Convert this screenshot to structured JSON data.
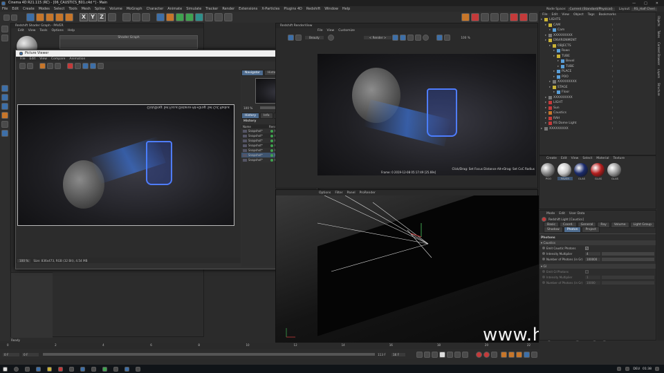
{
  "window_title": "Cinema 4D R21.115 (RC) - [06_CAUSTICS_B01.c4d *] - Main",
  "window_controls": [
    "—",
    "□",
    "✕"
  ],
  "main_menu": [
    "File",
    "Edit",
    "Create",
    "Modes",
    "Select",
    "Tools",
    "Mesh",
    "Spline",
    "Volume",
    "MoGraph",
    "Character",
    "Animate",
    "Simulate",
    "Tracker",
    "Render",
    "Extensions",
    "X-Particles",
    "Plugins 4D",
    "Redshift",
    "Window",
    "Help"
  ],
  "layout": {
    "node_space_label": "Node Space:",
    "node_space_value": "Current (Standard/Physical)",
    "layout_label": "Layout:",
    "layout_value": "RS_Half Cheri"
  },
  "axis_buttons": [
    "X",
    "Y",
    "Z"
  ],
  "shader_graph": {
    "title": "Redshift Shader Graph - PAVER",
    "menu": [
      "Edit",
      "View",
      "Tools",
      "Options",
      "Help"
    ],
    "node_title": "Shader Graph"
  },
  "picture_viewer": {
    "title": "Picture Viewer",
    "menu": [
      "File",
      "Edit",
      "View",
      "Compare",
      "Animation"
    ],
    "nav_tabs": [
      "Navigator",
      "Histogram"
    ],
    "zoom": "100 %",
    "tabs": [
      "History",
      "Info",
      "Layer",
      "Filter",
      "Stereo"
    ],
    "history_header": "History",
    "columns": [
      "Name",
      "",
      "Render Time",
      "R",
      "Resolution"
    ],
    "rows": [
      {
        "name": "Snapshot*",
        "time": "00:00:59",
        "res": "836x230"
      },
      {
        "name": "Snapshot*",
        "time": "00:00:21",
        "res": "836x230"
      },
      {
        "name": "Snapshot*",
        "time": "00:00:11",
        "res": "836x230"
      },
      {
        "name": "Snapshot*",
        "time": "00:00:20",
        "res": "836x230"
      },
      {
        "name": "Snapshot*",
        "time": "00:00:18",
        "res": "836x473"
      },
      {
        "name": "Snapshot*",
        "time": "00:00:22",
        "res": "836x473"
      },
      {
        "name": "Snapshot*",
        "time": "00:00:08",
        "res": "836x473"
      }
    ],
    "mirrored_caption": "Click/Drag: Set Focus Distance Alt+Drag: Set CoC Radius",
    "status_zoom": "100 %",
    "status_text": "Size: 836x473, RGB (32 Bit), 4.54 MB"
  },
  "renderview": {
    "title": "Redshift RenderView",
    "menu": [
      "File",
      "View",
      "Customize"
    ],
    "mode": "Beauty",
    "render_dropdown": "< Render >",
    "zoom": "100 %",
    "frame_info": "Frame: 0   2019-12-08 05:17:49  [25.69s]",
    "hint": "Click/Drag: Set Focus Distance Alt+Drag: Set CoC Radius"
  },
  "viewport_menu": [
    "Options",
    "Filter",
    "Panel",
    "ProRender"
  ],
  "object_manager": {
    "menu": [
      "File",
      "Edit",
      "View",
      "Object",
      "Tags",
      "Bookmarks"
    ],
    "items": [
      {
        "name": "LIGHTS",
        "indent": 0,
        "color": "#c9b236"
      },
      {
        "name": "CAM",
        "indent": 1,
        "color": "#c9b236"
      },
      {
        "name": "Cam",
        "indent": 2,
        "color": "#5a9fd8"
      },
      {
        "name": "XXXXXXXXX",
        "indent": 1,
        "color": "#777"
      },
      {
        "name": "ENVIRONMENT",
        "indent": 1,
        "color": "#c9b236"
      },
      {
        "name": "OBJECTS",
        "indent": 2,
        "color": "#c9b236"
      },
      {
        "name": "Rows",
        "indent": 3,
        "color": "#5a9fd8"
      },
      {
        "name": "TUBE",
        "indent": 3,
        "color": "#c9b236"
      },
      {
        "name": "Bevel",
        "indent": 4,
        "color": "#5a9fd8"
      },
      {
        "name": "TUBE",
        "indent": 4,
        "color": "#5a9fd8"
      },
      {
        "name": "PLACE",
        "indent": 3,
        "color": "#5a9fd8"
      },
      {
        "name": "POO",
        "indent": 3,
        "color": "#5a9fd8"
      },
      {
        "name": "XXXXXXXXX",
        "indent": 2,
        "color": "#777"
      },
      {
        "name": "STAGE",
        "indent": 2,
        "color": "#c9b236"
      },
      {
        "name": "Floor",
        "indent": 3,
        "color": "#5a9fd8"
      },
      {
        "name": "XXXXXXXXX",
        "indent": 1,
        "color": "#777"
      },
      {
        "name": "LIGHT",
        "indent": 1,
        "color": "#c43a3a"
      },
      {
        "name": "Sun",
        "indent": 1,
        "color": "#c43a3a"
      },
      {
        "name": "Caustics",
        "indent": 1,
        "color": "#c7762a"
      },
      {
        "name": "RAH",
        "indent": 1,
        "color": "#c43a3a"
      },
      {
        "name": "RS Dome Light",
        "indent": 1,
        "color": "#c43a3a"
      },
      {
        "name": "XXXXXXXXX",
        "indent": 0,
        "color": "#777"
      }
    ]
  },
  "material_manager": {
    "menu": [
      "Create",
      "Edit",
      "View",
      "Select",
      "Material",
      "Texture"
    ],
    "materials": [
      {
        "name": "POO",
        "color": "#8a8a8a"
      },
      {
        "name": "PAVER",
        "color": "#c9c9c9"
      },
      {
        "name": "GLAS",
        "color": "#1a2a6a"
      },
      {
        "name": "GLAS",
        "color": "#b41e1e"
      },
      {
        "name": "GLAS",
        "color": "#9a9a9a"
      }
    ]
  },
  "attributes": {
    "menu": [
      "Mode",
      "Edit",
      "User Data"
    ],
    "object_title": "Redshift Light [Caustics]",
    "tabs_row1": [
      "Basic",
      "Coord.",
      "General",
      "Ray",
      "Volume",
      "Light Group"
    ],
    "tabs_row2": [
      "Shadow",
      "Photon",
      "Project"
    ],
    "active_tab": "Photon",
    "section": "Photons",
    "caustics_header": "Caustics",
    "caustics": [
      {
        "label": "Emit Caustic Photons",
        "type": "check",
        "value": "✓"
      },
      {
        "label": "Intensity Multiplier",
        "type": "num",
        "value": "4"
      },
      {
        "label": "Number of Photons (in Gr)",
        "type": "num",
        "value": "100000"
      }
    ],
    "gi_header": "GI",
    "gi": [
      {
        "label": "Emit GI Photons",
        "type": "check",
        "value": ""
      },
      {
        "label": "Intensity Multiplier",
        "type": "num",
        "value": "1"
      },
      {
        "label": "Number of Photons (in Gr)",
        "type": "num",
        "value": "10000"
      }
    ]
  },
  "timeline": {
    "ticks": [
      "0",
      "2",
      "4",
      "6",
      "8",
      "10",
      "12",
      "14",
      "16",
      "18",
      "20",
      "22"
    ],
    "start": "0 F",
    "end": "0 F",
    "max": "113 F",
    "fps": "16 F",
    "status": "Ready"
  },
  "watermark": "www.hunls.com",
  "taskbar": {
    "lang": "DEU",
    "time": "01:38"
  },
  "right_tabs": [
    "Objects",
    "Takes",
    "Content Browser",
    "Layers",
    "Structure"
  ]
}
